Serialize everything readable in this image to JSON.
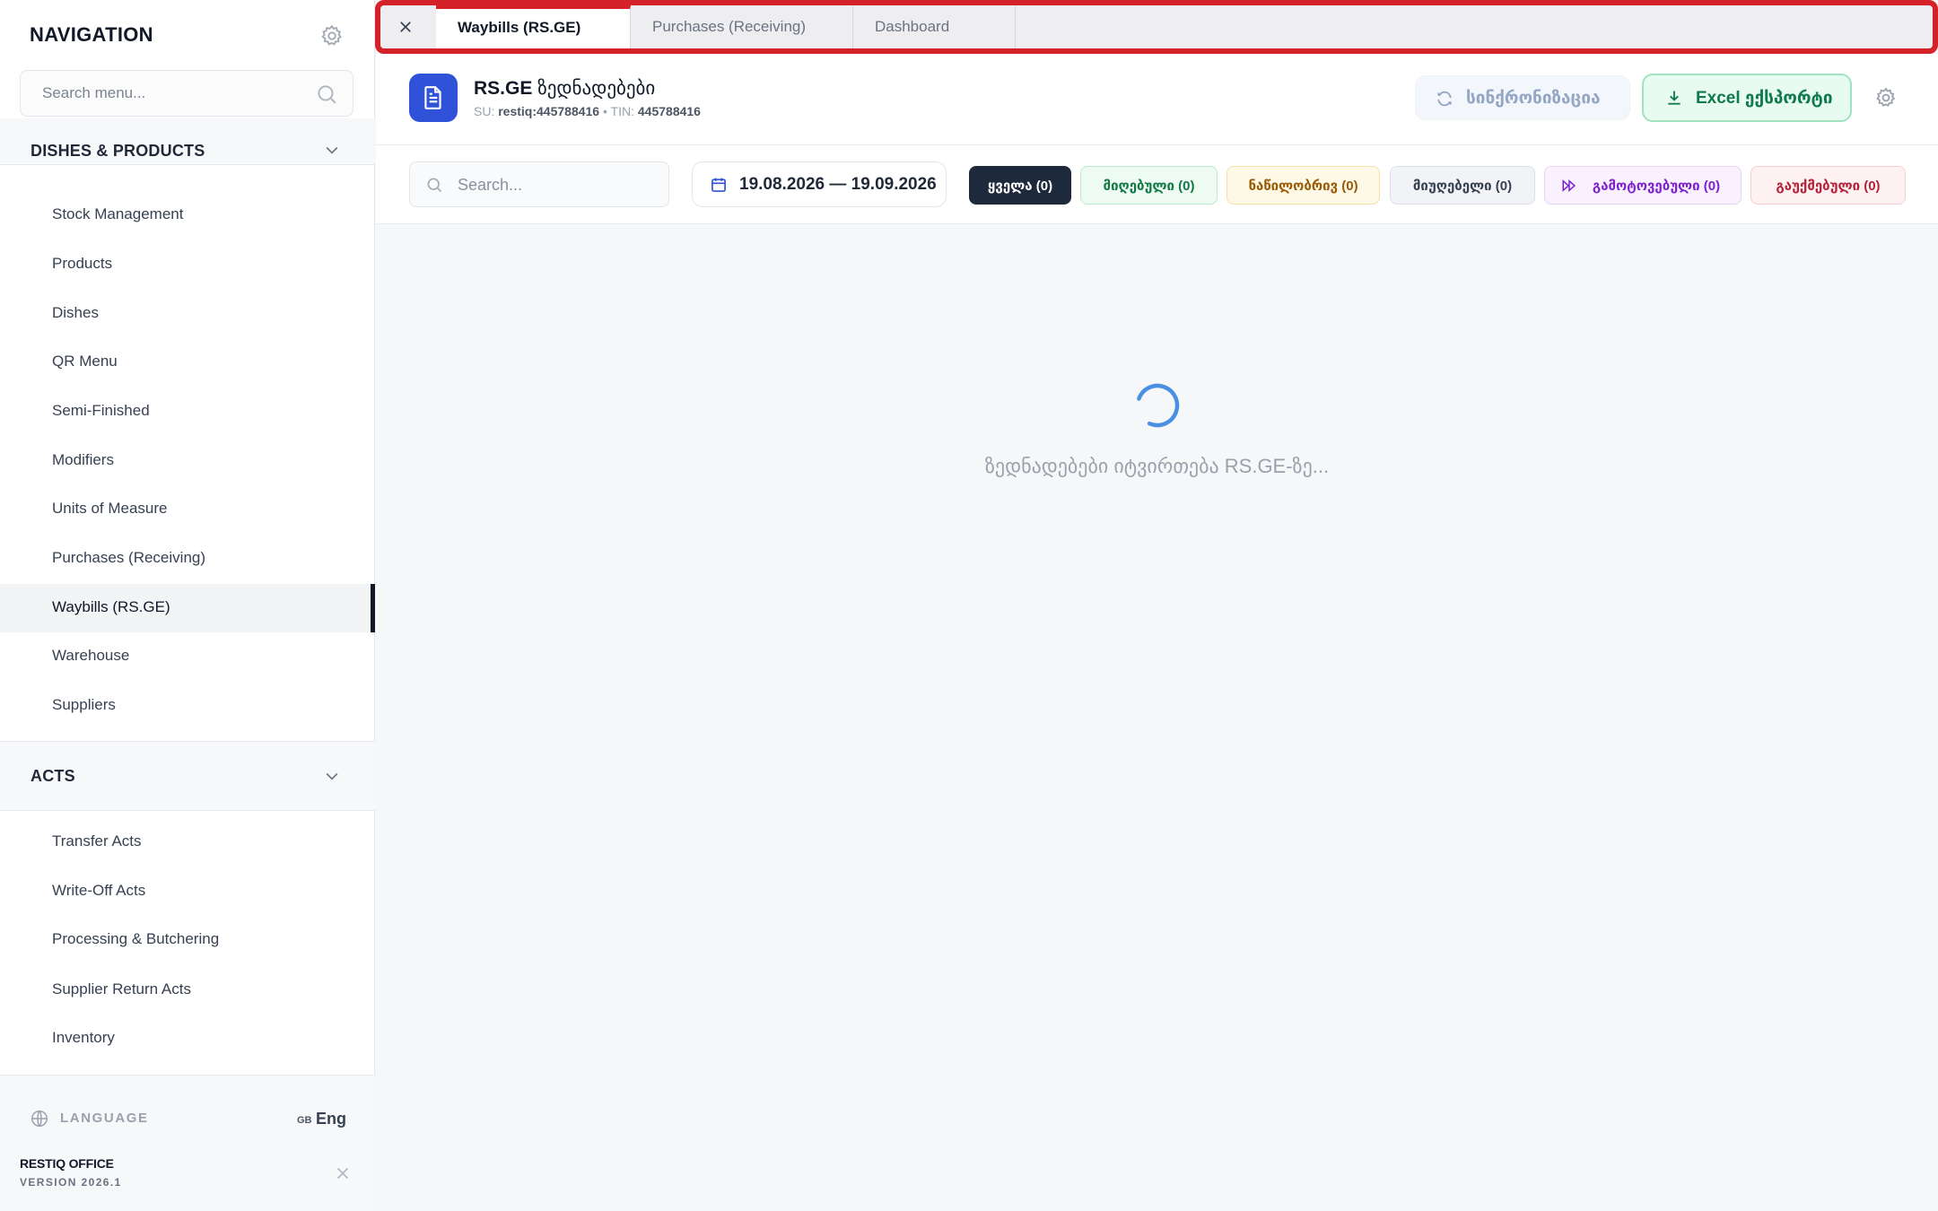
{
  "sidebar": {
    "title": "NAVIGATION",
    "search_placeholder": "Search menu...",
    "groups": [
      {
        "title": "DISHES & PRODUCTS"
      },
      {
        "title": "ACTS"
      }
    ],
    "items": [
      {
        "label": "Stock Management"
      },
      {
        "label": "Products"
      },
      {
        "label": "Dishes"
      },
      {
        "label": "QR Menu"
      },
      {
        "label": "Semi-Finished"
      },
      {
        "label": "Modifiers"
      },
      {
        "label": "Units of Measure"
      },
      {
        "label": "Purchases (Receiving)"
      },
      {
        "label": "Waybills (RS.GE)",
        "active": true
      },
      {
        "label": "Warehouse"
      },
      {
        "label": "Suppliers"
      }
    ],
    "acts_items": [
      {
        "label": "Transfer Acts"
      },
      {
        "label": "Write-Off Acts"
      },
      {
        "label": "Processing & Butchering"
      },
      {
        "label": "Supplier Return Acts"
      },
      {
        "label": "Inventory"
      }
    ],
    "footer": {
      "language_label": "LANGUAGE",
      "language_flag": "GB",
      "language_value": "Eng",
      "brand": "RESTIQ OFFICE",
      "version": "VERSION 2026.1"
    }
  },
  "tabs": [
    {
      "label": "Waybills (RS.GE)",
      "active": true
    },
    {
      "label": "Purchases (Receiving)",
      "active": false
    },
    {
      "label": "Dashboard",
      "active": false
    }
  ],
  "header": {
    "title_bold": "RS.GE",
    "title_rest": " ზედნადებები",
    "su_label": "SU: ",
    "su_value": "restiq:445788416",
    "sep": " • ",
    "tin_label": "TIN: ",
    "tin_value": "445788416",
    "sync_label": "სინქრონიზაცია",
    "excel_label": "Excel ექსპორტი"
  },
  "filters": {
    "search_placeholder": "Search...",
    "date_range": "19.08.2026 — 19.09.2026",
    "chips": [
      {
        "label": "ყველა (0)"
      },
      {
        "label": "მიღებული (0)"
      },
      {
        "label": "ნაწილობრივ (0)"
      },
      {
        "label": "მიუღებელი (0)"
      },
      {
        "label": "გამოტოვებული (0)"
      },
      {
        "label": "გაუქმებული (0)"
      }
    ]
  },
  "loading": {
    "text": "ზედნადებები იტვირთება RS.GE-ზე..."
  },
  "colors": {
    "accent_blue": "#2f52d8",
    "highlight_red": "#d42228",
    "excel_green": "#0f7a4a",
    "spinner_blue": "#4a90e2"
  }
}
